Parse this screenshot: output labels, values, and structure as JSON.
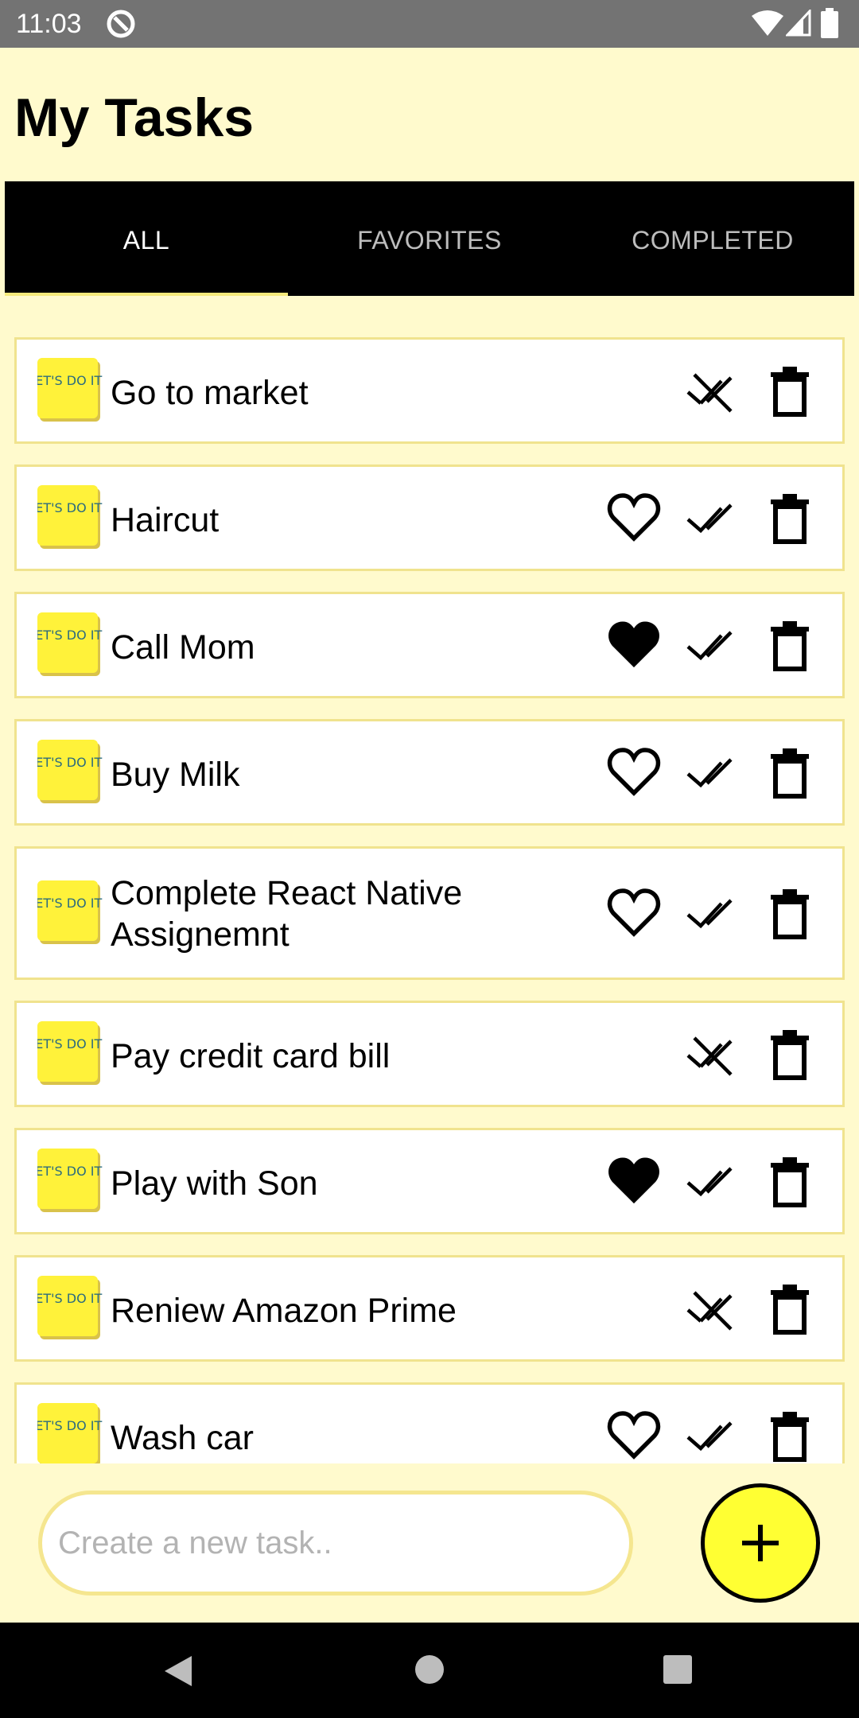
{
  "status_bar": {
    "time": "11:03"
  },
  "header": {
    "title": "My Tasks"
  },
  "tabs": [
    {
      "label": "ALL",
      "active": true
    },
    {
      "label": "FAVORITES",
      "active": false
    },
    {
      "label": "COMPLETED",
      "active": false
    }
  ],
  "sticker_text": "LET'S DO IT!",
  "tasks": [
    {
      "title": "Go to market",
      "completed": true,
      "favorite": false
    },
    {
      "title": "Haircut",
      "completed": false,
      "favorite": false
    },
    {
      "title": "Call Mom",
      "completed": false,
      "favorite": true
    },
    {
      "title": "Buy Milk",
      "completed": false,
      "favorite": false
    },
    {
      "title": "Complete React Native Assignemnt",
      "completed": false,
      "favorite": false
    },
    {
      "title": "Pay credit card bill",
      "completed": true,
      "favorite": false
    },
    {
      "title": "Play with Son",
      "completed": false,
      "favorite": true
    },
    {
      "title": "Reniew Amazon Prime",
      "completed": true,
      "favorite": false
    },
    {
      "title": "Wash car",
      "completed": false,
      "favorite": false
    }
  ],
  "new_task": {
    "placeholder": "Create a new task..",
    "value": ""
  },
  "colors": {
    "background": "#fffacd",
    "accent": "#ffff33",
    "card_border": "#f0e38e",
    "tab_bar": "#000000",
    "indicator": "#f5e97a"
  }
}
